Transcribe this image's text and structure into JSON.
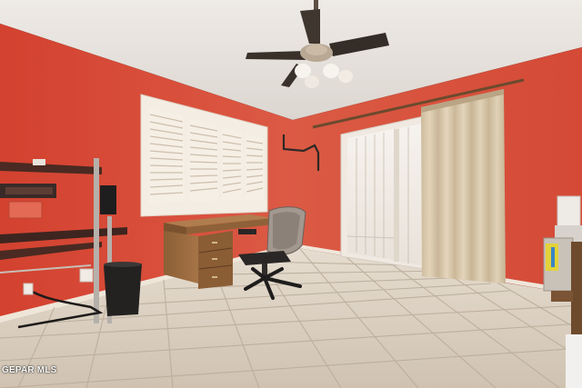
{
  "photo": {
    "watermark": "GEPAR MLS"
  },
  "colors": {
    "wall": "#d64b3a",
    "ceiling": "#e8e4e0",
    "floor_tile": "#d9cdbd",
    "grout": "#b8ab9b",
    "curtain": "#d9c9ae",
    "desk_wood": "#9a6a40",
    "shutter": "#f3ece2"
  },
  "icons": [
    "ceiling-fan",
    "window-shutters",
    "sliding-door",
    "curtain",
    "desk",
    "office-chair",
    "shelving-unit",
    "trash-can"
  ]
}
